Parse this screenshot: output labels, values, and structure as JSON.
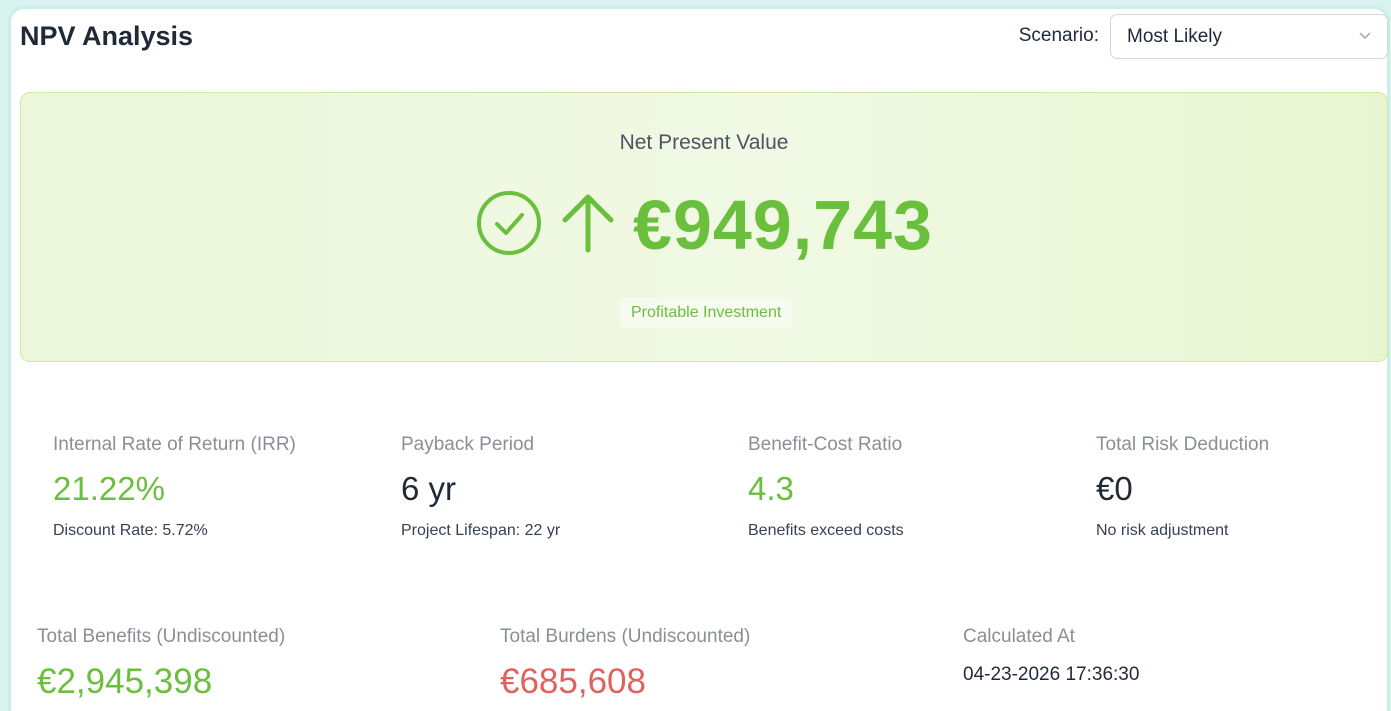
{
  "header": {
    "title": "NPV Analysis",
    "scenario_label": "Scenario:",
    "scenario_value": "Most Likely"
  },
  "hero": {
    "label": "Net Present Value",
    "value": "€949,743",
    "badge": "Profitable Investment"
  },
  "metrics": [
    {
      "label": "Internal Rate of Return (IRR)",
      "value": "21.22%",
      "sub": "Discount Rate: 5.72%"
    },
    {
      "label": "Payback Period",
      "value": "6 yr",
      "sub": "Project Lifespan: 22 yr"
    },
    {
      "label": "Benefit-Cost Ratio",
      "value": "4.3",
      "sub": "Benefits exceed costs"
    },
    {
      "label": "Total Risk Deduction",
      "value": "€0",
      "sub": "No risk adjustment"
    }
  ],
  "totals": {
    "benefits_label": "Total Benefits (Undiscounted)",
    "benefits_value": "€2,945,398",
    "burdens_label": "Total Burdens (Undiscounted)",
    "burdens_value": "€685,608",
    "calculated_label": "Calculated At",
    "calculated_value": "04-23-2026 17:36:30"
  },
  "colors": {
    "positive": "#6abf3c",
    "negative": "#e0625f",
    "accent_border": "#c9efe8"
  },
  "icons": [
    "check-circle-icon",
    "arrow-up-icon",
    "chevron-down-icon"
  ]
}
